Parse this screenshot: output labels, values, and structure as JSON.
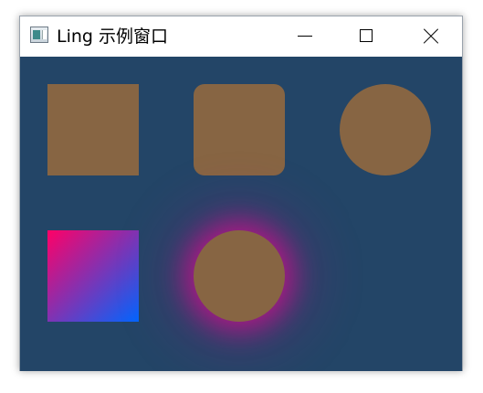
{
  "window": {
    "title": "Ling 示例窗口",
    "icon": "app-window-icon",
    "controls": {
      "minimize": "minimize-icon",
      "maximize": "maximize-icon",
      "close": "close-icon"
    }
  },
  "client": {
    "background_color": "#234567",
    "shapes": [
      {
        "kind": "square",
        "fill": "#876543"
      },
      {
        "kind": "rounded-square",
        "fill": "#876543"
      },
      {
        "kind": "circle",
        "fill": "#876543"
      },
      {
        "kind": "gradient-square",
        "gradient_from": "#ff0066",
        "gradient_to": "#0066ff"
      },
      {
        "kind": "glow-circle",
        "fill": "#876543",
        "glow_color": "#ff0096"
      }
    ]
  }
}
